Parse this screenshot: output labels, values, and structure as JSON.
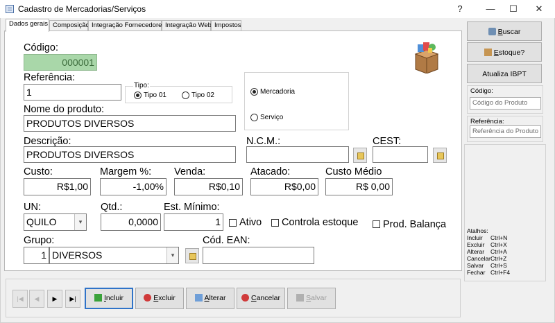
{
  "window": {
    "title": "Cadastro de Mercadorias/Serviços",
    "help": "?",
    "minimize": "—",
    "maximize": "☐",
    "close": "✕"
  },
  "tabs": [
    "Dados gerais",
    "Composição",
    "Integração Fornecedores",
    "Integração Web",
    "Impostos"
  ],
  "form": {
    "codigo_label": "Código:",
    "codigo_value": "000001",
    "referencia_label": "Referência:",
    "referencia_value": "1",
    "tipo": {
      "label": "Tipo:",
      "option1": "Tipo 01",
      "option2": "Tipo 02"
    },
    "natureza": {
      "option1": "Mercadoria",
      "option2": "Serviço"
    },
    "nome_label": "Nome do produto:",
    "nome_value": "PRODUTOS DIVERSOS",
    "descricao_label": "Descrição:",
    "descricao_value": "PRODUTOS DIVERSOS",
    "ncm_label": "N.C.M.:",
    "ncm_value": "",
    "cest_label": "CEST:",
    "cest_value": "",
    "custo_label": "Custo:",
    "custo_value": "R$1,00",
    "margem_label": "Margem %:",
    "margem_value": "-1,00%",
    "venda_label": "Venda:",
    "venda_value": "R$0,10",
    "atacado_label": "Atacado:",
    "atacado_value": "R$0,00",
    "custo_medio_label": "Custo Médio",
    "custo_medio_value": "R$ 0,00",
    "un_label": "UN:",
    "un_value": "QUILO",
    "qtd_label": "Qtd.:",
    "qtd_value": "0,0000",
    "est_min_label": "Est. Mínimo:",
    "est_min_value": "1",
    "ativo_label": "Ativo",
    "controla_label": "Controla estoque",
    "balanca_label": "Prod. Balança",
    "grupo_label": "Grupo:",
    "grupo_num": "1",
    "grupo_value": "DIVERSOS",
    "ean_label": "Cód. EAN:",
    "ean_value": ""
  },
  "sidebar": {
    "buscar_pre": "",
    "buscar_u": "B",
    "buscar_post": "uscar",
    "estoque_pre": "",
    "estoque_u": "E",
    "estoque_post": "stoque?",
    "ibpt": "Atualiza IBPT",
    "codigo_label": "Código:",
    "codigo_placeholder": "Código do Produto",
    "referencia_label": "Referência:",
    "referencia_placeholder": "Referência do Produto",
    "atalhos_title": "Atalhos:",
    "atalhos": [
      {
        "action": "Incluir",
        "key": "Ctrl+N"
      },
      {
        "action": "Excluir",
        "key": "Ctrl+X"
      },
      {
        "action": "Alterar",
        "key": "Ctrl+A"
      },
      {
        "action": "Cancelar",
        "key": "Ctrl+Z"
      },
      {
        "action": "Salvar",
        "key": "Ctrl+S"
      },
      {
        "action": "Fechar",
        "key": "Ctrl+F4"
      }
    ]
  },
  "nav": {
    "first": "|◀",
    "prev": "◀",
    "next": "▶",
    "last": "▶|"
  },
  "actions": {
    "incluir_u": "I",
    "incluir_post": "ncluir",
    "excluir_u": "E",
    "excluir_post": "xcluir",
    "alterar_u": "A",
    "alterar_post": "lterar",
    "cancelar_u": "C",
    "cancelar_post": "ancelar",
    "salvar_u": "S",
    "salvar_post": "alvar"
  },
  "colors": {
    "codigo_bg": "#a9d7a9",
    "codigo_text": "#3b6b3b",
    "focus_border": "#2f73c8"
  },
  "icons": {
    "product_box": "product-box-icon"
  }
}
